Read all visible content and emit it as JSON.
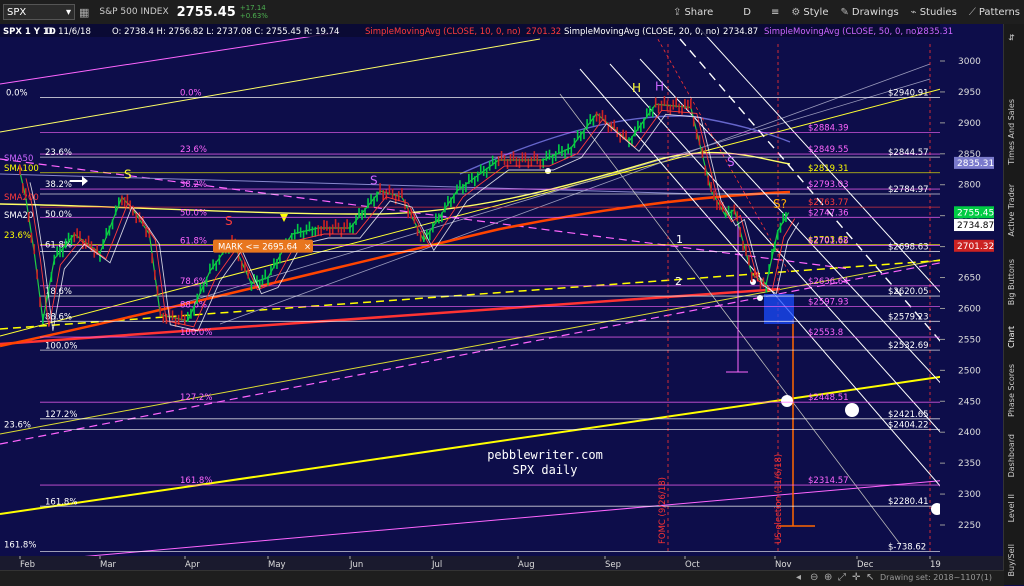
{
  "toolbar": {
    "symbol": "SPX",
    "name": "S&P 500 INDEX",
    "price": "2755.45",
    "change_abs": "+17.14",
    "change_pct": "+0.63%",
    "period": "D",
    "buttons": [
      "Share",
      "Style",
      "Drawings",
      "Studies",
      "Patterns"
    ],
    "icons": [
      "grid-icon",
      "list-icon",
      "gear-icon"
    ]
  },
  "legend": {
    "symbol": "SPX 1 Y 1D",
    "date": "D: 11/6/18",
    "ohlc": "O: 2738.4  H: 2756.82  L: 2737.08  C: 2755.45  R: 19.74",
    "sma10": "SimpleMovingAvg (CLOSE, 10, 0, no)",
    "sma10_val": "2701.32",
    "sma20": "SimpleMovingAvg (CLOSE, 20, 0, no)",
    "sma20_val": "2734.87",
    "sma50": "SimpleMovingAvg (CLOSE, 50, 0, no)",
    "sma50_val": "2835.31"
  },
  "colors": {
    "background": "#0d0d4a",
    "sma10": "#ff3b3b",
    "sma20": "#ffffff",
    "sma50": "#cc66ff",
    "fib": "#ff66ff",
    "yellow": "#ffff00",
    "orange": "#ff6600",
    "price_green": "#00cc44",
    "price_red": "#cc2222"
  },
  "chart_data": {
    "type": "line",
    "ylim": [
      2200,
      3030
    ],
    "y_ticks": [
      2250,
      2300,
      2350,
      2400,
      2450,
      2500,
      2550,
      2600,
      2650,
      2700,
      2750,
      2800,
      2850,
      2900,
      2950,
      3000
    ],
    "x_ticks": [
      "Feb",
      "Mar",
      "Apr",
      "May",
      "Jun",
      "Jul",
      "Aug",
      "Sep",
      "Oct",
      "Nov",
      "Dec",
      "19"
    ],
    "watermark": [
      "pebblewriter.com",
      "SPX daily"
    ],
    "price_path": [
      [
        "Feb 1",
        2820
      ],
      [
        "Feb 3",
        2780
      ],
      [
        "Feb 6",
        2690
      ],
      [
        "Feb 9",
        2580
      ],
      [
        "Feb 13",
        2680
      ],
      [
        "Feb 20",
        2720
      ],
      [
        "Mar 1",
        2690
      ],
      [
        "Mar 9",
        2780
      ],
      [
        "Mar 13",
        2760
      ],
      [
        "Mar 19",
        2720
      ],
      [
        "Mar 23",
        2590
      ],
      [
        "Apr 2",
        2580
      ],
      [
        "Apr 10",
        2660
      ],
      [
        "Apr 18",
        2710
      ],
      [
        "Apr 25",
        2640
      ],
      [
        "May 1",
        2650
      ],
      [
        "May 10",
        2720
      ],
      [
        "May 20",
        2730
      ],
      [
        "Jun 1",
        2730
      ],
      [
        "Jun 12",
        2790
      ],
      [
        "Jun 20",
        2780
      ],
      [
        "Jun 28",
        2710
      ],
      [
        "Jul 10",
        2790
      ],
      [
        "Jul 25",
        2840
      ],
      [
        "Aug 10",
        2840
      ],
      [
        "Aug 20",
        2860
      ],
      [
        "Aug 29",
        2915
      ],
      [
        "Sep 10",
        2870
      ],
      [
        "Sep 20",
        2930
      ],
      [
        "Oct 3",
        2925
      ],
      [
        "Oct 10",
        2790
      ],
      [
        "Oct 15",
        2750
      ],
      [
        "Oct 18",
        2760
      ],
      [
        "Oct 24",
        2655
      ],
      [
        "Oct 29",
        2640
      ],
      [
        "Nov 2",
        2725
      ],
      [
        "Nov 6",
        2755
      ]
    ],
    "price_scale_labels": [
      {
        "text": "2755.45",
        "value": 2755.45,
        "color": "#00cc44"
      },
      {
        "text": "2734.87",
        "value": 2734.87,
        "color": "#ffffff"
      },
      {
        "text": "2701.32",
        "value": 2701.32,
        "color": "#cc2222"
      },
      {
        "text": "2835.31",
        "value": 2835.31,
        "color": "#7a7acc"
      }
    ],
    "fib_left": [
      {
        "text": "0.0%",
        "value": 2940.91
      },
      {
        "text": "23.6%",
        "value": 2849.55
      },
      {
        "text": "38.2%",
        "value": 2793.03
      },
      {
        "text": "50.0%",
        "value": 2747.36
      },
      {
        "text": "61.8%",
        "value": 2701.68
      },
      {
        "text": "78.6%",
        "value": 2636.64
      },
      {
        "text": "88.6%",
        "value": 2597.93
      },
      {
        "text": "100.0%",
        "value": 2553.8
      },
      {
        "text": "127.2%",
        "value": 2448.51
      },
      {
        "text": "161.8%",
        "value": 2314.57
      }
    ],
    "levels_right": [
      {
        "text": "$2940.91",
        "value": 2940.91,
        "color": "#ffffff"
      },
      {
        "text": "$2884.39",
        "value": 2884.39,
        "color": "#ff66ff"
      },
      {
        "text": "$2849.55",
        "value": 2849.55,
        "color": "#ff66ff"
      },
      {
        "text": "$2844.57",
        "value": 2844.57,
        "color": "#ffffff"
      },
      {
        "text": "$2819.31",
        "value": 2819.31,
        "color": "#ffff00"
      },
      {
        "text": "$2793.03",
        "value": 2793.03,
        "color": "#ff66ff"
      },
      {
        "text": "$2784.97",
        "value": 2784.97,
        "color": "#ffffff"
      },
      {
        "text": "$2763.77",
        "value": 2763.77,
        "color": "#ff3b3b"
      },
      {
        "text": "$2747.36",
        "value": 2747.36,
        "color": "#ff66ff"
      },
      {
        "text": "$2703.62",
        "value": 2703.62,
        "color": "#ffff00"
      },
      {
        "text": "$2701.68",
        "value": 2701.68,
        "color": "#ff66ff"
      },
      {
        "text": "$2698.63",
        "value": 2692,
        "color": "#ffffff"
      },
      {
        "text": "$2636.64",
        "value": 2636.64,
        "color": "#ff66ff"
      },
      {
        "text": "$2620.05",
        "value": 2620.05,
        "color": "#ffffff"
      },
      {
        "text": "$2597.93",
        "value": 2603,
        "color": "#ff66ff"
      },
      {
        "text": "$2579.23",
        "value": 2579.23,
        "color": "#ffffff"
      },
      {
        "text": "$2553.8",
        "value": 2553.8,
        "color": "#ff66ff"
      },
      {
        "text": "$2532.69",
        "value": 2532.69,
        "color": "#ffffff"
      },
      {
        "text": "$2448.51",
        "value": 2448.51,
        "color": "#ff66ff"
      },
      {
        "text": "$2421.65",
        "value": 2421.65,
        "color": "#ffffff"
      },
      {
        "text": "$2404.22",
        "value": 2404.22,
        "color": "#ffffff"
      },
      {
        "text": "$2314.57",
        "value": 2314.57,
        "color": "#ff66ff"
      },
      {
        "text": "$2280.41",
        "value": 2280.41,
        "color": "#ffffff"
      },
      {
        "text": "$-738.62",
        "value": 2207,
        "color": "#ffffff"
      }
    ],
    "left_labels": [
      {
        "text": "0.0%",
        "value": 2940.91
      },
      {
        "text": "23.6%",
        "value": 2844.57
      },
      {
        "text": "SMA50",
        "value": 2835
      },
      {
        "text": "SMA100",
        "value": 2819
      },
      {
        "text": "38.2%",
        "value": 2793
      },
      {
        "text": "SMA200",
        "value": 2772
      },
      {
        "text": "50.0%",
        "value": 2745
      },
      {
        "text": "SMA20",
        "value": 2743
      },
      {
        "text": "23.6%",
        "value": 2711
      },
      {
        "text": "61.8%",
        "value": 2695
      },
      {
        "text": "78.6%",
        "value": 2620
      },
      {
        "text": "88.6%",
        "value": 2579
      },
      {
        "text": "100.0%",
        "value": 2532
      },
      {
        "text": "127.2%",
        "value": 2421
      },
      {
        "text": "23.6%",
        "value": 2404
      },
      {
        "text": "161.8%",
        "value": 2280
      },
      {
        "text": "161.8%",
        "value": 2210
      }
    ],
    "left_label_colors": [
      "#ffffff",
      "#ffffff",
      "#cc66ff",
      "#ffff00",
      "#ffffff",
      "#ff3b3b",
      "#ffffff",
      "#ffffff",
      "#ffff00",
      "#ffffff",
      "#ffffff",
      "#ffffff",
      "#ffffff",
      "#ffffff",
      "#ffffff",
      "#ffffff",
      "#ffffff"
    ],
    "annotations": {
      "mark": "MARK <= 2695.64",
      "pattern_letters": [
        "S",
        "H",
        "S",
        "H",
        "S",
        "S?",
        "S"
      ],
      "wave_labels": [
        "1",
        "2"
      ],
      "fomc": "FOMC (9/26/18)",
      "election": "US election (11/6/18)"
    }
  },
  "sidebar_tabs": [
    "Times And Sales",
    "Active Trader",
    "Big Buttons",
    "Chart",
    "Phase Scores",
    "Dashboard",
    "Level II",
    "Buy/Sell"
  ],
  "bottombar": {
    "drawing_set": "Drawing set: 2018~1107(1)"
  }
}
